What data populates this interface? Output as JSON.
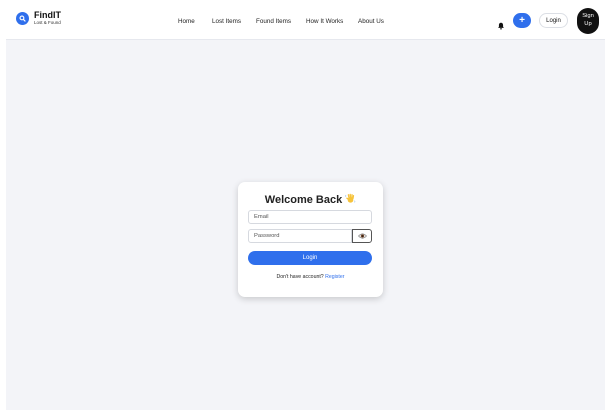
{
  "navbar": {
    "brand_name": "FindIT",
    "brand_sub": "Lost & Found",
    "links": [
      "Home",
      "Lost Items",
      "Found Items",
      "How It Works",
      "About Us"
    ],
    "add_label": "+",
    "login_label": "Login",
    "signup_label": "Sign Up"
  },
  "login_card": {
    "title": "Welcome Back",
    "email_placeholder": "Email",
    "password_placeholder": "Password",
    "submit_label": "Login",
    "no_account_text": "Don't have account?",
    "register_label": "Register"
  },
  "icons": {
    "brand": "search-icon",
    "notifications": "bell-icon",
    "password_toggle": "eye-icon",
    "title_emoji": "waving-hand-icon"
  },
  "colors": {
    "accent": "#2f6fec",
    "background": "#f3f4f8",
    "signup": "#111111"
  }
}
